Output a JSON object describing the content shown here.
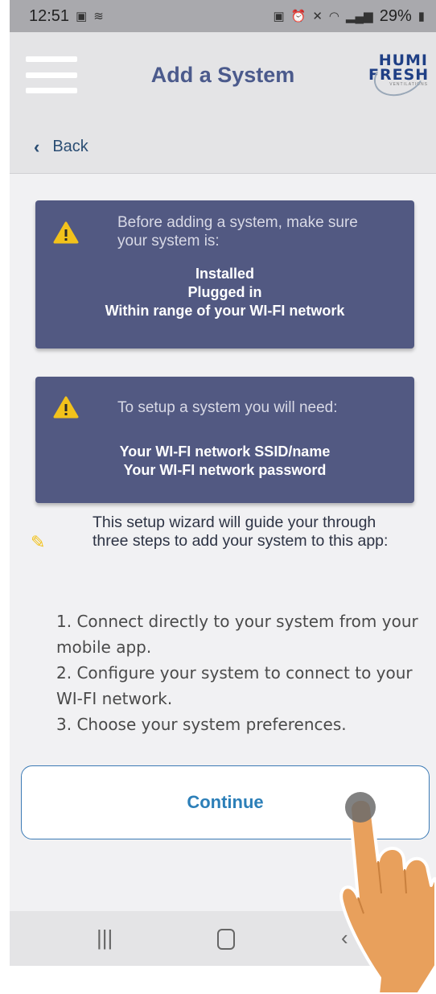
{
  "status_bar": {
    "time": "12:51",
    "left_icons": [
      "gallery-icon",
      "notification-icon"
    ],
    "right_icons": [
      "lock-icon",
      "alarm-icon",
      "mute-icon",
      "wifi-icon",
      "signal-icon"
    ],
    "battery": "29%"
  },
  "app_bar": {
    "title": "Add a System",
    "logo_line1": "HUMI",
    "logo_line2": "FRESH",
    "logo_tagline": "VENTILATIONS"
  },
  "nav": {
    "back_label": "Back"
  },
  "card1": {
    "intro": "Before adding a system, make sure your system is:",
    "items": [
      "Installed",
      "Plugged in",
      "Within range of your WI-FI network"
    ]
  },
  "card2": {
    "intro": "To setup a system you will need:",
    "items": [
      "Your WI-FI network SSID/name",
      "Your WI-FI network password"
    ]
  },
  "wizard_note": "This setup wizard will guide your through three steps to add your system to this app:",
  "steps": [
    "1. Connect directly to your system from your mobile app.",
    "2. Configure your system to connect to your WI-FI network.",
    "3. Choose your system preferences."
  ],
  "continue_label": "Continue",
  "colors": {
    "card_bg": "#525982",
    "title": "#4b5a8c",
    "accent": "#2c7fb8",
    "warning": "#f2c21b"
  }
}
